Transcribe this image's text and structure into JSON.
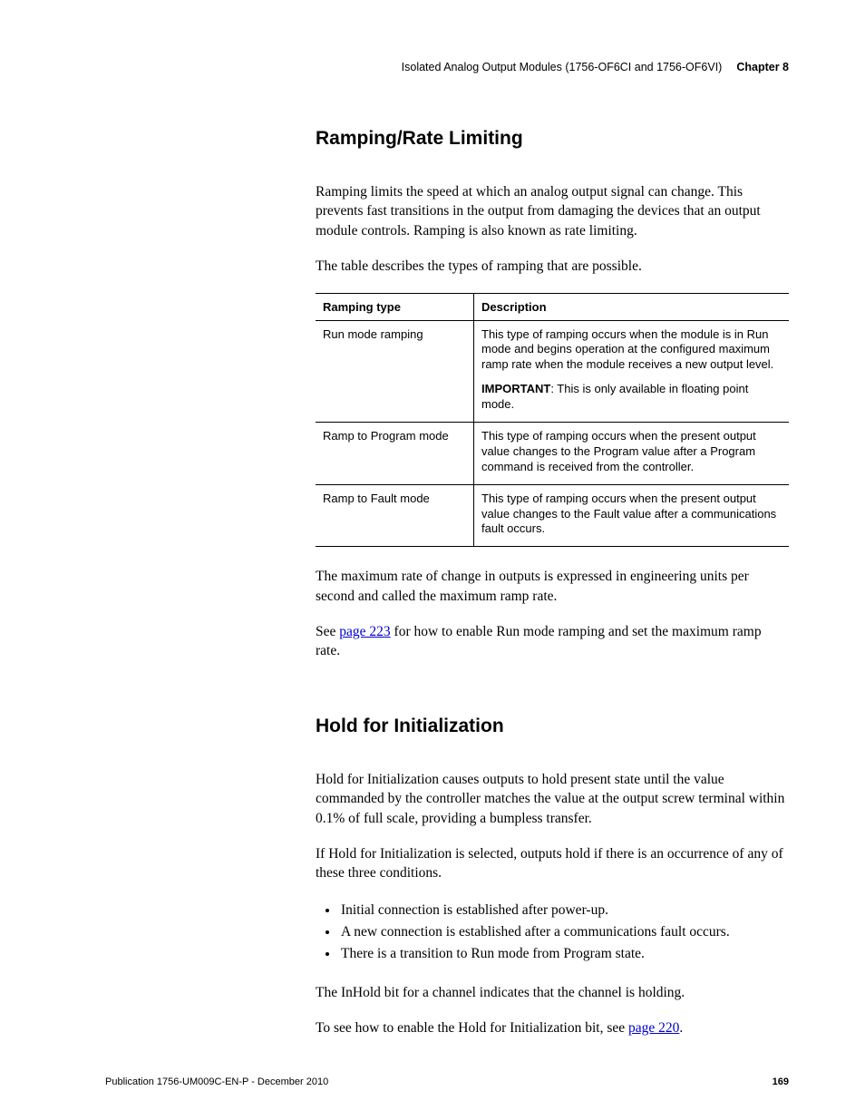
{
  "header": {
    "title": "Isolated Analog Output Modules (1756-OF6CI and 1756-OF6VI)",
    "chapter": "Chapter 8"
  },
  "section1": {
    "heading": "Ramping/Rate Limiting",
    "p1": "Ramping limits the speed at which an analog output signal can change. This prevents fast transitions in the output from damaging the devices that an output module controls. Ramping is also known as rate limiting.",
    "p2": "The table describes the types of ramping that are possible.",
    "table": {
      "head": {
        "c1": "Ramping type",
        "c2": "Description"
      },
      "rows": [
        {
          "c1": "Run mode ramping",
          "c2a": "This type of ramping occurs when the module is in Run mode and begins operation at the configured maximum ramp rate when the module receives a new output level.",
          "c2b_prefix": "IMPORTANT",
          "c2b_rest": ": This is only available in floating point mode."
        },
        {
          "c1": "Ramp to Program mode",
          "c2a": "This type of ramping occurs when the present output value changes to the Program value after a Program command is received from the controller."
        },
        {
          "c1": "Ramp to Fault mode",
          "c2a": "This type of ramping occurs when the present output value changes to the Fault value after a communications fault occurs."
        }
      ]
    },
    "p3": "The maximum rate of change in outputs is expressed in engineering units per second and called the maximum ramp rate.",
    "p4_a": "See ",
    "p4_link": "page 223",
    "p4_b": " for how to enable Run mode ramping and set the maximum ramp rate."
  },
  "section2": {
    "heading": "Hold for Initialization",
    "p1": "Hold for Initialization causes outputs to hold present state until the value commanded by the controller matches the value at the output screw terminal within 0.1% of full scale, providing a bumpless transfer.",
    "p2": "If Hold for Initialization is selected, outputs hold if there is an occurrence of any of these three conditions.",
    "bullets": [
      "Initial connection is established after power-up.",
      "A new connection is established after a communications fault occurs.",
      "There is a transition to Run mode from Program state."
    ],
    "p3": "The InHold bit for a channel indicates that the channel is holding.",
    "p4_a": "To see how to enable the Hold for Initialization bit, see ",
    "p4_link": "page 220",
    "p4_b": "."
  },
  "footer": {
    "pub": "Publication 1756-UM009C-EN-P - December 2010",
    "page": "169"
  }
}
